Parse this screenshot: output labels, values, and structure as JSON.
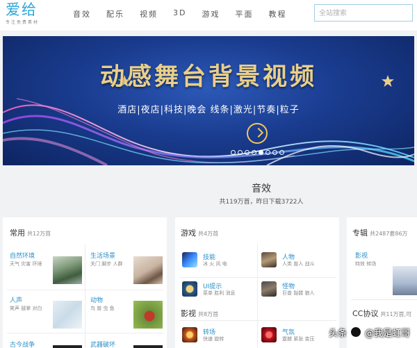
{
  "header": {
    "logo": "爱给",
    "logo_sub": "专注免费素材",
    "nav": [
      "音效",
      "配乐",
      "视频",
      "3D",
      "游戏",
      "平面",
      "教程"
    ],
    "search_placeholder": "全站搜索"
  },
  "banner": {
    "title": "动感舞台背景视频",
    "subtitle": "酒店|夜店|科技|晚会  线条|激光|节奏|粒子",
    "dots": 8,
    "active_dot": 5
  },
  "section": {
    "title": "音效",
    "subtitle": "共119万首，昨日下载3722人"
  },
  "cards": {
    "common": {
      "title": "常用",
      "count": "共12万首",
      "items": [
        {
          "title": "自然环境",
          "sub": "天气 灾害 环境"
        },
        {
          "title": "生活场景",
          "sub": "关门 脚步 人群"
        },
        {
          "title": "人声",
          "sub": "笑声 鼓掌 对白"
        },
        {
          "title": "动物",
          "sub": "鸟 兽 虫 鱼"
        },
        {
          "title": "古今战争",
          "sub": ""
        },
        {
          "title": "武器破坏",
          "sub": ""
        }
      ]
    },
    "game": {
      "title": "游戏",
      "count": "共4万首",
      "items": [
        {
          "title": "技能",
          "sub": "冰 火 风 电"
        },
        {
          "title": "人物",
          "sub": "人类 兽人 战斗"
        },
        {
          "title": "UI提示",
          "sub": "菜单 胜利 消息"
        },
        {
          "title": "怪物",
          "sub": "巨兽 骷髅 狼人"
        }
      ],
      "sub_title": "影视",
      "sub_count": "共8万首",
      "items2": [
        {
          "title": "转场",
          "sub": "快速 旋转"
        },
        {
          "title": "气氛",
          "sub": "震撼 紧张 变压"
        }
      ]
    },
    "special": {
      "title": "专辑",
      "count": "共2487套86万",
      "items": [
        {
          "title": "影视",
          "sub": "特效 转场"
        }
      ],
      "cc_title": "CC协议",
      "cc_count": "共11万首,可"
    }
  },
  "watermark": {
    "text_left": "头条",
    "text_right": "@我是虹哥"
  },
  "colors": {
    "link": "#2a8fc8",
    "logo": "#2aa7d8",
    "banner_title": "#e9cf8a",
    "accent": "#f2c75c"
  }
}
